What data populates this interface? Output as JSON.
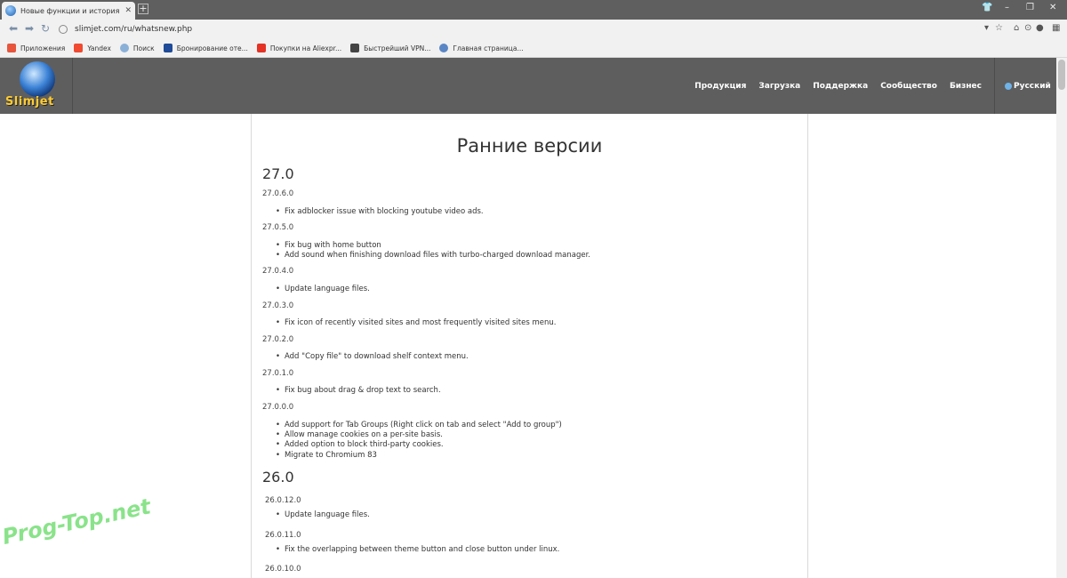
{
  "browser": {
    "tab_title": "Новые функции и история изме",
    "url": "slimjet.com/ru/whatsnew.php",
    "bookmarks": [
      {
        "label": "Приложения",
        "color": "#e7553d"
      },
      {
        "label": "Yandex",
        "color": "#f04a30"
      },
      {
        "label": "Поиск",
        "color": "#8ab0d8"
      },
      {
        "label": "Бронирование оте...",
        "color": "#1f4b98"
      },
      {
        "label": "Покупки на Aliexpr...",
        "color": "#e43225"
      },
      {
        "label": "Быстрейший VPN...",
        "color": "#444444"
      },
      {
        "label": "Главная страница...",
        "color": "#5b86c5"
      }
    ]
  },
  "site": {
    "logo_text": "Slimjet",
    "nav": [
      "Продукция",
      "Загрузка",
      "Поддержка",
      "Сообщество",
      "Бизнес"
    ],
    "language": "Русский",
    "header_color": "#5e5e5e"
  },
  "page": {
    "title": "Ранние версии",
    "v27": {
      "heading": "27.0",
      "releases": [
        {
          "version": "27.0.6.0",
          "items": [
            "Fix adblocker issue with blocking youtube video ads."
          ]
        },
        {
          "version": "27.0.5.0",
          "items": [
            "Fix bug with home button",
            "Add sound when finishing download files with turbo-charged download manager."
          ]
        },
        {
          "version": "27.0.4.0",
          "items": [
            "Update language files."
          ]
        },
        {
          "version": "27.0.3.0",
          "items": [
            "Fix icon of recently visited sites and most frequently visited sites menu."
          ]
        },
        {
          "version": "27.0.2.0",
          "items": [
            "Add \"Copy file\" to download shelf context menu."
          ]
        },
        {
          "version": "27.0.1.0",
          "items": [
            "Fix bug about drag & drop text to search."
          ]
        },
        {
          "version": "27.0.0.0",
          "items": [
            "Add support for Tab Groups (Right click on tab and select \"Add to group\")",
            "Allow manage cookies on a per-site basis.",
            "Added option to block third-party cookies.",
            "Migrate to Chromium 83"
          ]
        }
      ]
    },
    "v26": {
      "heading": "26.0",
      "releases": [
        {
          "version": "26.0.12.0",
          "items": [
            "Update language files."
          ]
        },
        {
          "version": "26.0.11.0",
          "items": [
            "Fix the overlapping between theme button and close button under linux."
          ]
        },
        {
          "version": "26.0.10.0",
          "items": []
        }
      ]
    }
  },
  "watermark": "Prog-Top.net"
}
